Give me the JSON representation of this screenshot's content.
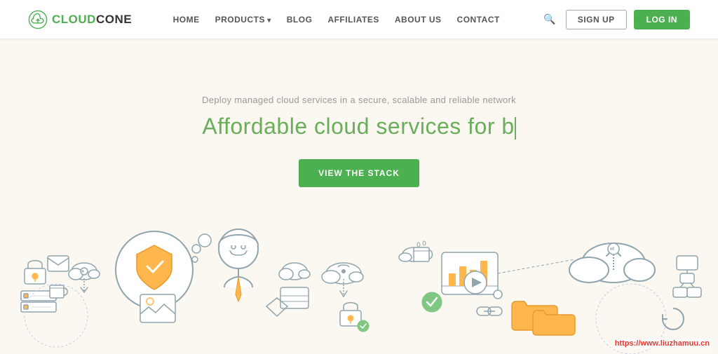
{
  "navbar": {
    "logo_text": "CLOUDCONE",
    "nav_items": [
      {
        "label": "HOME",
        "has_dropdown": false
      },
      {
        "label": "PRODUCTS",
        "has_dropdown": true
      },
      {
        "label": "BLOG",
        "has_dropdown": false
      },
      {
        "label": "AFFILIATES",
        "has_dropdown": false
      },
      {
        "label": "ABOUT US",
        "has_dropdown": false
      },
      {
        "label": "CONTACT",
        "has_dropdown": false
      }
    ],
    "signup_label": "SIGN UP",
    "login_label": "LOG IN"
  },
  "hero": {
    "subtitle": "Deploy managed cloud services in a secure, scalable and reliable network",
    "title_prefix": "Affordable cloud services for b",
    "cta_label": "VIEW THE STACK"
  },
  "watermark": {
    "text": "https://www.liuzhamuu.cn"
  }
}
